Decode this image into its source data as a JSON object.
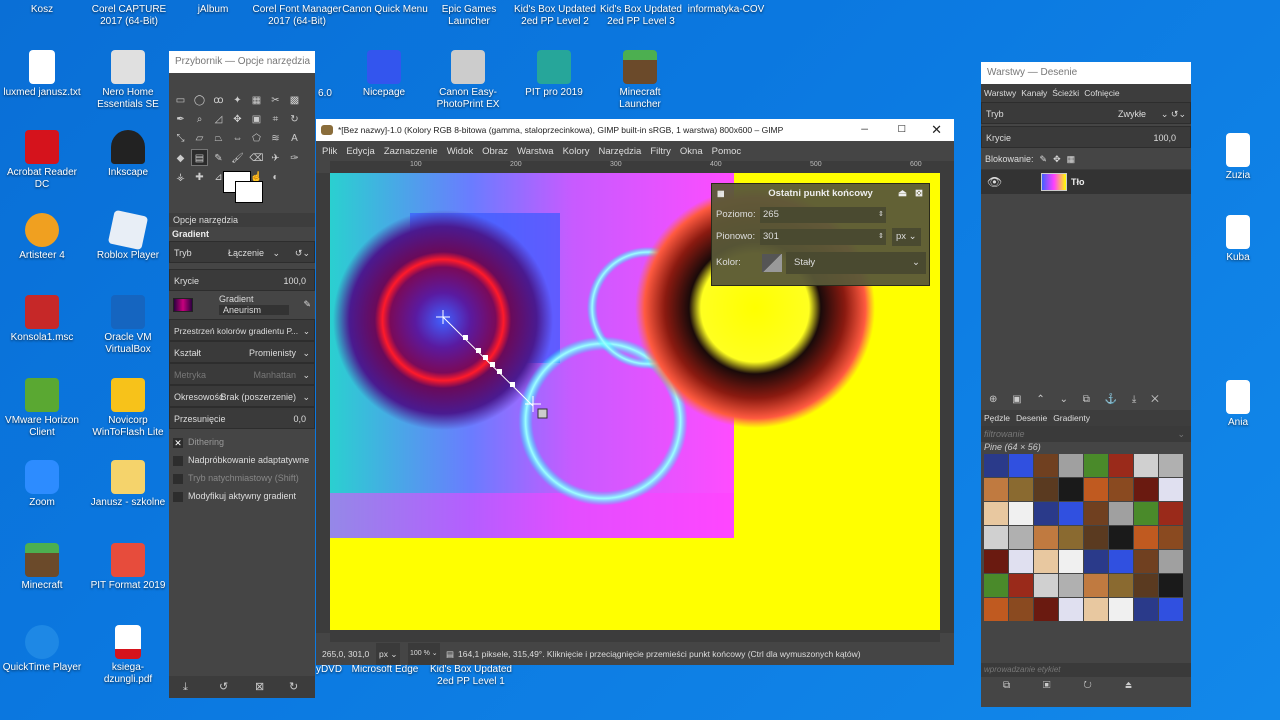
{
  "desktop": {
    "top_labels": [
      "Kosz",
      "Corel CAPTURE 2017 (64-Bit)",
      "jAlbum",
      "Corel Font Manager 2017 (64-Bit)",
      "Canon Quick Menu",
      "Epic Games Launcher",
      "Kid's Box Updated 2ed PP Level 2",
      "Kid's Box Updated 2ed PP Level 3",
      "informatyka-COV"
    ],
    "icons_col1": [
      "luxmed janusz.txt",
      "Acrobat Reader DC",
      "Artisteer 4",
      "Konsola1.msc",
      "VMware Horizon Client",
      "Zoom",
      "Minecraft",
      "QuickTime Player"
    ],
    "icons_col2": [
      "Nero Home Essentials SE",
      "Inkscape",
      "Roblox Player",
      "Oracle VM VirtualBox",
      "Novicorp WinToFlash Lite",
      "Janusz - szkolne",
      "PIT Format 2019",
      "ksiega-dzungli.pdf"
    ],
    "icons_mid": [
      "Nicepage",
      "Canon Easy-PhotoPrint EX",
      "PIT pro 2019",
      "Minecraft Launcher"
    ],
    "icons_right": [
      "Zuzia",
      "Kuba",
      "Ania"
    ],
    "partial_labels": [
      "6.0",
      "yDVD",
      "Microsoft Edge",
      "Kid's Box Updated 2ed PP Level 1"
    ]
  },
  "toolbox": {
    "title": "Przybornik — Opcje narzędzia",
    "tab": "Opcje narzędzia",
    "section": "Gradient",
    "mode_label": "Tryb",
    "mode_value": "Łączenie",
    "opacity_label": "Krycie",
    "opacity_value": "100,0",
    "gradient_label": "Gradient",
    "gradient_name": "Aneurism",
    "colorspace": "Przestrzeń kolorów gradientu P...",
    "shape_label": "Kształt",
    "shape_value": "Promienisty",
    "metric_label": "Metryka",
    "metric_value": "Manhattan",
    "repeat_label": "Okresowość",
    "repeat_value": "Brak (poszerzenie)",
    "offset_label": "Przesunięcie",
    "offset_value": "0,0",
    "checks": [
      {
        "label": "Dithering",
        "checked": true
      },
      {
        "label": "Nadpróbkowanie adaptatywne",
        "checked": false
      },
      {
        "label": "Tryb natychmiastowy  (Shift)",
        "checked": false
      },
      {
        "label": "Modyfikuj aktywny gradient",
        "checked": false
      }
    ]
  },
  "gimp": {
    "title": "*[Bez nazwy]-1.0 (Kolory RGB 8-bitowa (gamma, staloprzecinkowa), GIMP built-in sRGB, 1 warstwa) 800x600 – GIMP",
    "menu": [
      "Plik",
      "Edycja",
      "Zaznaczenie",
      "Widok",
      "Obraz",
      "Warstwa",
      "Kolory",
      "Narzędzia",
      "Filtry",
      "Okna",
      "Pomoc"
    ],
    "ruler": [
      "100",
      "200",
      "300",
      "400",
      "500",
      "600",
      "700"
    ],
    "status_coords": "265,0, 301,0",
    "status_unit": "px",
    "status_zoom": "100 %",
    "status_msg": "164,1 piksele, 315,49°. Kliknięcie i przeciągnięcie przemieści punkt końcowy (Ctrl dla wymuszonych kątów)"
  },
  "endpoint_dialog": {
    "title": "Ostatni punkt końcowy",
    "x_label": "Poziomo:",
    "x_value": "265",
    "y_label": "Pionowo:",
    "y_value": "301",
    "unit": "px",
    "color_label": "Kolor:",
    "color_value": "Stały"
  },
  "layers": {
    "title": "Warstwy — Desenie",
    "tabs": [
      "Warstwy",
      "Kanały",
      "Ścieżki",
      "Cofnięcie"
    ],
    "mode_label": "Tryb",
    "mode_value": "Zwykłe",
    "opacity_label": "Krycie",
    "opacity_value": "100,0",
    "lock_label": "Blokowanie:",
    "layer_name": "Tło",
    "pattern_tabs": [
      "Pędzle",
      "Desenie",
      "Gradienty"
    ],
    "filter_placeholder": "filtrowanie",
    "pattern_name": "Pine (64 × 56)",
    "tags_placeholder": "wprowadzanie etykiet"
  },
  "colors": {
    "gimp_bg": "#454545",
    "dialog": "#5a5838",
    "canvas_yellow": "#ffff00"
  }
}
